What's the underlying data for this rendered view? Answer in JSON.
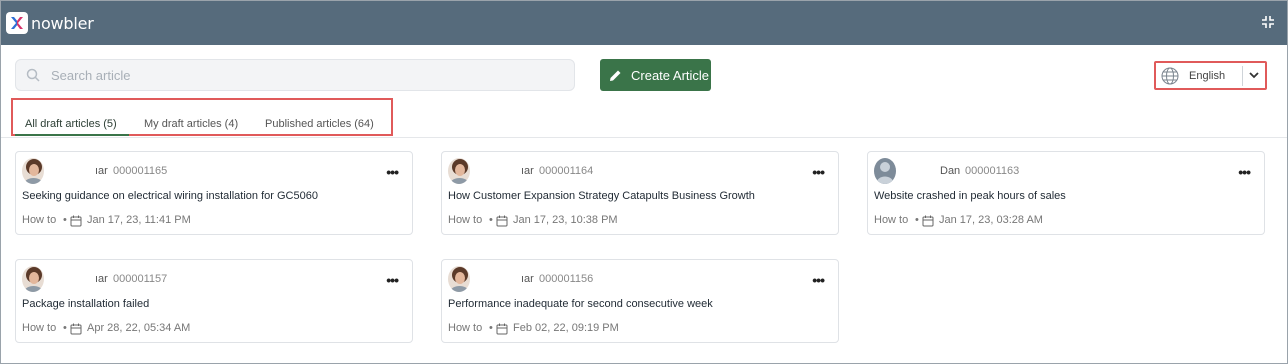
{
  "app": {
    "logo_text": "nowbler"
  },
  "header": {
    "collapse_icon": "collapse-arrows-icon"
  },
  "search": {
    "placeholder": "Search article",
    "icon": "search-icon"
  },
  "create_button": {
    "label": "Create Article",
    "icon": "pencil-icon"
  },
  "language": {
    "label": "English",
    "icon": "globe-icon"
  },
  "tabs": [
    {
      "label": "All draft articles (5)",
      "active": true
    },
    {
      "label": "My draft articles (4)",
      "active": false
    },
    {
      "label": "Published articles (64)",
      "active": false
    }
  ],
  "colors": {
    "header": "#566b7c",
    "accent": "#3a7449",
    "highlight": "#e05a5a"
  },
  "articles": [
    {
      "author": "ıar",
      "code": "000001165",
      "title": "Seeking guidance on electrical wiring installation for GC5060",
      "type": "How to",
      "date": "Jan 17, 23, 11:41 PM",
      "avatar": "photo"
    },
    {
      "author": "ıar",
      "code": "000001164",
      "title": "How Customer Expansion Strategy Catapults Business Growth",
      "type": "How to",
      "date": "Jan 17, 23, 10:38 PM",
      "avatar": "photo"
    },
    {
      "author": "Dan",
      "code": "000001163",
      "title": "Website crashed in peak hours of sales",
      "type": "How to",
      "date": "Jan 17, 23, 03:28 AM",
      "avatar": "placeholder"
    },
    {
      "author": "ıar",
      "code": "000001157",
      "title": "Package installation failed",
      "type": "How to",
      "date": "Apr 28, 22, 05:34 AM",
      "avatar": "photo"
    },
    {
      "author": "ıar",
      "code": "000001156",
      "title": "Performance inadequate for second consecutive week",
      "type": "How to",
      "date": "Feb 02, 22, 09:19 PM",
      "avatar": "photo"
    }
  ]
}
